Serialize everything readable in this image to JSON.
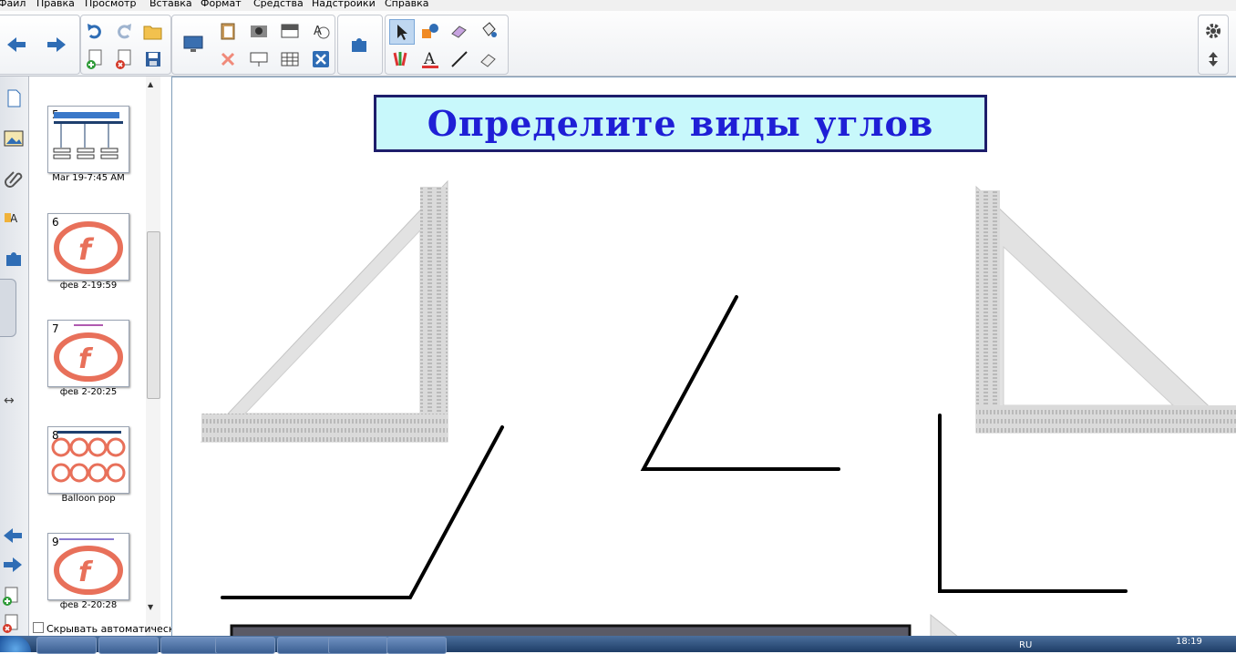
{
  "menu": [
    "Файл",
    "Правка",
    "Просмотр",
    "Вставка",
    "Формат",
    "Средства",
    "Надстройки",
    "Справка"
  ],
  "slides": [
    {
      "num": "5",
      "caption": "Mar 19-7:45 AM"
    },
    {
      "num": "6",
      "caption": "фев 2-19:59"
    },
    {
      "num": "7",
      "caption": "фев 2-20:25"
    },
    {
      "num": "8",
      "caption": "Balloon pop"
    },
    {
      "num": "9",
      "caption": "фев 2-20:28"
    }
  ],
  "sorter": {
    "hide_label": "Скрывать автоматическ"
  },
  "page": {
    "title": "Определите  виды углов"
  },
  "taskbar": {
    "clock": "18:19",
    "lang": "RU"
  },
  "colors": {
    "title_bg": "#c8f8fb",
    "title_text": "#1f1fd6",
    "title_border": "#1d1d6b",
    "accent": "#2f6db5"
  }
}
